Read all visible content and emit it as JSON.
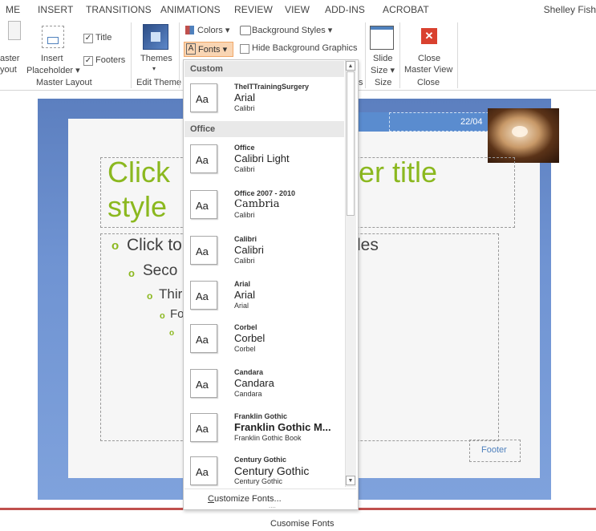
{
  "tabs": [
    "ME",
    "INSERT",
    "TRANSITIONS",
    "ANIMATIONS",
    "REVIEW",
    "VIEW",
    "ADD-INS",
    "ACROBAT"
  ],
  "user_name": "Shelley Fish",
  "ribbon": {
    "master_layout": {
      "layout_label_1": "aster",
      "layout_label_2": "yout",
      "insert_label_1": "Insert",
      "insert_label_2": "Placeholder ▾",
      "title_check": "Title",
      "footers_check": "Footers",
      "group_label": "Master Layout",
      "check_mark": "✓"
    },
    "edit_theme": {
      "themes_label": "Themes",
      "themes_arrow": "▾",
      "group_label": "Edit Theme"
    },
    "background": {
      "colors_label": "Colors ▾",
      "fonts_label": "Fonts ▾",
      "bg_styles_label": "Background Styles ▾",
      "hide_bg_label": "Hide Background Graphics",
      "group_label_fragment": "s"
    },
    "size": {
      "slide_size_1": "Slide",
      "slide_size_2": "Size ▾",
      "group_label": "Size"
    },
    "close": {
      "close_1": "Close",
      "close_2": "Master View",
      "group_label": "Close",
      "close_icon": "✕"
    }
  },
  "slide": {
    "title_text_left": "Click",
    "title_text_right": "er title",
    "title_line2": "style",
    "date_text": "22/04",
    "bullet1_left": "Click to",
    "bullet1_right": "les",
    "bullet2": "Seco",
    "bullet3": "Thir",
    "bullet4": "Fo",
    "bullet_glyph": "o",
    "footer_text": "Footer"
  },
  "dropdown": {
    "custom_header": "Custom",
    "office_header": "Office",
    "sample_text": "Aa",
    "custom_items": [
      {
        "name": "TheITTrainingSurgery",
        "heading": "Arial",
        "body": "Calibri"
      }
    ],
    "office_items": [
      {
        "name": "Office",
        "heading": "Calibri Light",
        "body": "Calibri"
      },
      {
        "name": "Office 2007 - 2010",
        "heading": "Cambria",
        "body": "Calibri"
      },
      {
        "name": "Calibri",
        "heading": "Calibri",
        "body": "Calibri"
      },
      {
        "name": "Arial",
        "heading": "Arial",
        "body": "Arial"
      },
      {
        "name": "Corbel",
        "heading": "Corbel",
        "body": "Corbel"
      },
      {
        "name": "Candara",
        "heading": "Candara",
        "body": "Candara"
      },
      {
        "name": "Franklin Gothic",
        "heading": "Franklin Gothic M...",
        "body": "Franklin Gothic Book"
      },
      {
        "name": "Century Gothic",
        "heading": "Century Gothic",
        "body": "Century Gothic"
      }
    ],
    "customize_prefix": "C",
    "customize_rest": "ustomize Fonts...",
    "more_dots": "....",
    "scroll_up": "▲",
    "scroll_down": "▼"
  },
  "caption": "Cusomise Fonts",
  "colors": {
    "accent_green": "#8bb81f",
    "close_red": "#d9412f",
    "footer_red": "#c0504d",
    "slide_blue": "#6f93d2"
  }
}
